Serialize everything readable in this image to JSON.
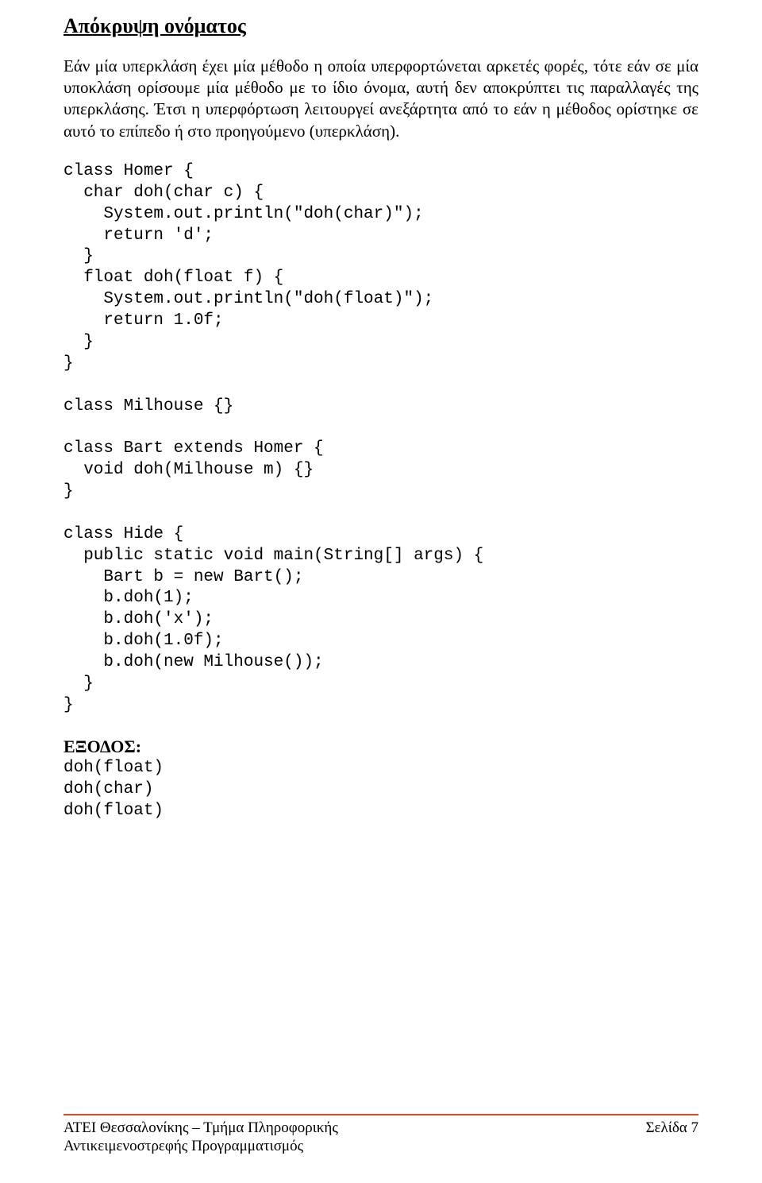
{
  "heading": " Απόκρυψη ονόματος",
  "paragraph": "Εάν μία υπερκλάση έχει μία μέθοδο η οποία υπερφορτώνεται αρκετές φορές, τότε εάν σε μία υποκλάση ορίσουμε μία μέθοδο με το ίδιο όνομα, αυτή δεν αποκρύπτει τις παραλλαγές της υπερκλάσης. Έτσι η υπερφόρτωση λειτουργεί ανεξάρτητα από το εάν η μέθοδος ορίστηκε σε αυτό το επίπεδο ή στο προηγούμενο (υπερκλάση).",
  "code": "class Homer {\n  char doh(char c) {\n    System.out.println(\"doh(char)\");\n    return 'd';\n  }\n  float doh(float f) {\n    System.out.println(\"doh(float)\");\n    return 1.0f;\n  }\n}\n\nclass Milhouse {}\n\nclass Bart extends Homer {\n  void doh(Milhouse m) {}\n}\n\nclass Hide {\n  public static void main(String[] args) {\n    Bart b = new Bart();\n    b.doh(1);\n    b.doh('x');\n    b.doh(1.0f);\n    b.doh(new Milhouse());\n  }\n}",
  "output_label": "ΕΞΟΔΟΣ:",
  "output": "doh(float)\ndoh(char)\ndoh(float)",
  "footer": {
    "line1": "ΑΤΕΙ Θεσσαλονίκης – Τμήμα Πληροφορικής",
    "line2": "Αντικειμενοστρεφής Προγραμματισμός",
    "page": "Σελίδα 7"
  }
}
